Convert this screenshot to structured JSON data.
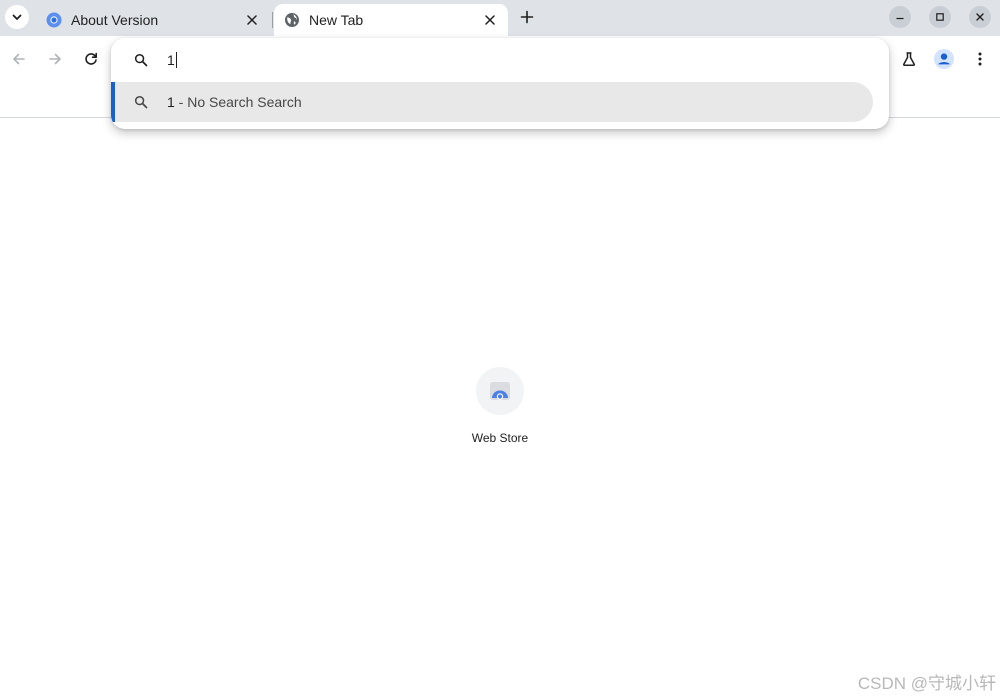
{
  "tabs": [
    {
      "title": "About Version",
      "active": false,
      "icon": "chromium-logo-icon"
    },
    {
      "title": "New Tab",
      "active": true,
      "icon": "globe-icon"
    }
  ],
  "omnibox": {
    "input_value": "1",
    "suggestion": {
      "query": "1",
      "suffix": " - No Search Search"
    }
  },
  "shortcuts": [
    {
      "label": "Web Store",
      "icon": "web-store-icon"
    }
  ],
  "watermark": "CSDN @守城小轩",
  "colors": {
    "tabstrip": "#dfe3e8",
    "selection_bar": "#1a5fd0",
    "suggestion_bg": "#e8e8e8",
    "profile_accent": "#1a5fd0"
  }
}
